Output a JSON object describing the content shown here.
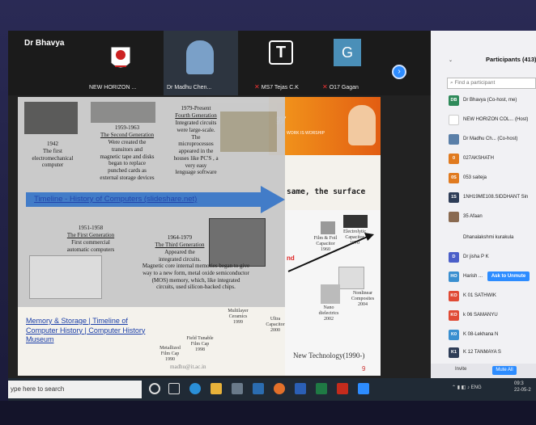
{
  "meeting": {
    "host_name": "Dr Bhavya",
    "tiles": [
      {
        "label": "NEW HORIZON ...",
        "kind": "logo"
      },
      {
        "label": "Dr Madhu Chen...",
        "kind": "video"
      },
      {
        "label": "MS7 Tejas C.K",
        "kind": "letter",
        "letter": "T"
      },
      {
        "label": "O17 Gagan",
        "kind": "letter",
        "letter": "G"
      }
    ],
    "next_icon": "chevron-right-icon"
  },
  "slide": {
    "gen_1942": "1942\nThe first\nelectromechanical\ncomputer",
    "gen_second_years": "1959-1963",
    "gen_second_title": "The Second Generation",
    "gen_second_desc": "Were created the\ntransitors and\nmagnetic tape and disks\nbegan to replace\npunched cards as\nexternal storage devices",
    "gen_fourth_years": "1979-Present",
    "gen_fourth_title": "Fourth Generation",
    "gen_fourth_desc": "Integrated circuits\nwere large-scale.\nThe\nmicroprocessos\nappeared in the\nhouses like PC'S , a\nvery easy\nlenguage software",
    "timeline_link": "Timeline - History of Computers (slideshare.net)",
    "gen_first_years": "1951-1958",
    "gen_first_title": "The First Generation",
    "gen_first_desc": "First commercial\nautomatic computers",
    "gen_third_years": "1964-1979",
    "gen_third_title": "The Third Generation",
    "gen_third_desc": "Appeared the\nintegrated circuits.",
    "magnetic_core_text": "Magnetic core internal memories began to give\nway to a new form, metal oxide semiconductor\n(MOS) memory, which, like integrated\ncircuits, used silicon-backed chips.",
    "memory_link": "Memory & Storage | Timeline of Computer History | Computer History Museum",
    "orange_fragment": "gy",
    "orange_small": "WORK IS WORSHIP",
    "surface_text": "same, the surface",
    "red_fragment": "nd",
    "components": [
      {
        "name": "Electrolytic\nCapacitor",
        "year": "1970"
      },
      {
        "name": "Film & Foil\nCapacitor",
        "year": "1960"
      },
      {
        "name": "Nonlinear\nComposites",
        "year": "2004"
      },
      {
        "name": "Nano\ndielectrics",
        "year": "2002"
      },
      {
        "name": "Ultra\nCapacitor",
        "year": "2000"
      },
      {
        "name": "Multilayer\nCeramics",
        "year": "1999"
      },
      {
        "name": "Field Tunable\nFilm Cap",
        "year": "1998"
      },
      {
        "name": "Metallized\nFilm Cap",
        "year": "1990"
      }
    ],
    "new_technology": "New Technology(1990-)",
    "email": "madhu@it.ac.in",
    "slide_number": "9"
  },
  "participants": {
    "title": "Participants (413)",
    "search_placeholder": "Find a participant",
    "list": [
      {
        "initials": "DB",
        "color": "#2f8a5a",
        "name": "Dr Bhavya (Co-host, me)"
      },
      {
        "initials": "",
        "color": "#ffffff",
        "name": "NEW HORIZON COL... (Host)"
      },
      {
        "initials": "",
        "color": "#5a7fa8",
        "name": "Dr Madhu Ch... (Co-host)"
      },
      {
        "initials": "0",
        "color": "#e07a1f",
        "name": "027AKSHATH"
      },
      {
        "initials": "0S",
        "color": "#e07a1f",
        "name": "053 saiteja"
      },
      {
        "initials": "1S",
        "color": "#2e3d57",
        "name": "1NH19ME108.SIDDHANT Sin"
      },
      {
        "initials": "",
        "color": "#8a6a50",
        "name": "35 Afaan"
      },
      {
        "initials": "",
        "color": "#f1f1f4",
        "name": "Dhanalakshmi kurakula"
      },
      {
        "initials": "D",
        "color": "#4b5fc9",
        "name": "Dr jisha P K"
      },
      {
        "initials": "HO",
        "color": "#3a8fd0",
        "name": "Harish ..."
      },
      {
        "initials": "KO",
        "color": "#e04a35",
        "name": "K 01 SATHWIK"
      },
      {
        "initials": "KO",
        "color": "#e04a35",
        "name": "k 06 SAMANYU"
      },
      {
        "initials": "K0",
        "color": "#3a8fd0",
        "name": "K 08-Lekhana N"
      },
      {
        "initials": "K1",
        "color": "#2e3d57",
        "name": "K 12 TANMAYA S"
      }
    ],
    "ask_to_unmute": "Ask to Unmute",
    "invite": "Invite",
    "mute_all": "Mute All"
  },
  "taskbar": {
    "search_placeholder": "ype here to search",
    "tray": "ENG",
    "time": "09:3",
    "date": "22-05-2"
  }
}
